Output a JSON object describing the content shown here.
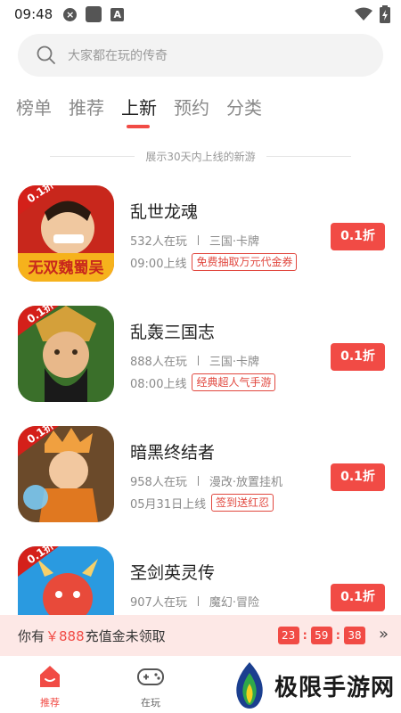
{
  "status_bar": {
    "time": "09:48",
    "icons": [
      "close-circle-icon",
      "square-icon",
      "a-icon",
      "wifi-icon",
      "battery-icon"
    ]
  },
  "search": {
    "placeholder": "大家都在玩的传奇",
    "icon": "search-icon"
  },
  "tabs": [
    {
      "label": "榜单",
      "active": false
    },
    {
      "label": "推荐",
      "active": false
    },
    {
      "label": "上新",
      "active": true
    },
    {
      "label": "预约",
      "active": false
    },
    {
      "label": "分类",
      "active": false
    }
  ],
  "section_caption": "展示30天内上线的新游",
  "games": [
    {
      "name": "乱世龙魂",
      "players": "532人在玩",
      "genre": "三国·卡牌",
      "launch": "09:00上线",
      "tag": "免费抽取万元代金券",
      "discount": "0.1折",
      "icon_badge": "0.1折",
      "icon_text": "无双魏蜀吴",
      "icon_colors": [
        "#c8271c",
        "#f6b21c"
      ]
    },
    {
      "name": "乱轰三国志",
      "players": "888人在玩",
      "genre": "三国·卡牌",
      "launch": "08:00上线",
      "tag": "经典超人气手游",
      "discount": "0.1折",
      "icon_badge": "0.1折",
      "icon_text": "",
      "icon_colors": [
        "#3a6f2a",
        "#d4a03a"
      ]
    },
    {
      "name": "暗黑终结者",
      "players": "958人在玩",
      "genre": "漫改·放置挂机",
      "launch": "05月31日上线",
      "tag": "签到送红忍",
      "discount": "0.1折",
      "icon_badge": "0.1折",
      "icon_text": "",
      "icon_colors": [
        "#6b4a2a",
        "#f0a040"
      ]
    },
    {
      "name": "圣剑英灵传",
      "players": "907人在玩",
      "genre": "魔幻·冒险",
      "launch": "",
      "tag": "",
      "discount": "0.1折",
      "icon_badge": "0.1折",
      "icon_text": "",
      "icon_colors": [
        "#2a9ae0",
        "#e84a3a"
      ]
    }
  ],
  "recharge": {
    "prefix": "你有",
    "amount": "￥888",
    "suffix": "充值金未领取",
    "countdown": [
      "23",
      "59",
      "38"
    ],
    "arrow": "»"
  },
  "bottom_nav": [
    {
      "label": "推荐",
      "icon": "home-icon",
      "active": true
    },
    {
      "label": "在玩",
      "icon": "gamepad-icon",
      "active": false
    }
  ],
  "watermark": {
    "text": "极限手游网",
    "logo": "flame-logo-icon"
  },
  "colors": {
    "accent": "#f14b45",
    "tag_red": "#e1483f",
    "muted": "#8a8a8a",
    "recharge_bg": "#fde8e6"
  }
}
